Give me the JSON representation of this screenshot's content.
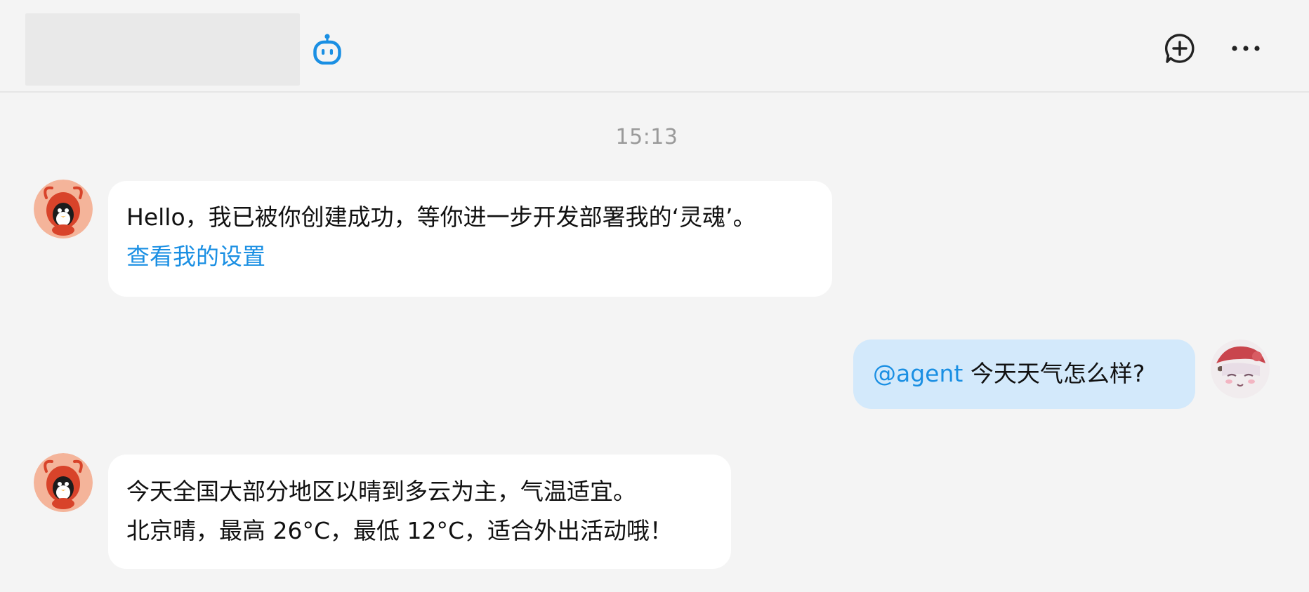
{
  "header": {
    "bot_icon": "robot-icon",
    "add_icon": "add-comment-icon",
    "more_icon": "more-dots-icon"
  },
  "timestamp": "15:13",
  "messages": [
    {
      "sender": "agent",
      "lines": [
        "Hello，我已被你创建成功，等你进一步开发部署我的‘灵魂’。"
      ],
      "link": "查看我的设置"
    },
    {
      "sender": "user",
      "mention": "@agent",
      "text": " 今天天气怎么样?"
    },
    {
      "sender": "agent",
      "lines": [
        "今天全国大部分地区以晴到多云为主，气温适宜。",
        "北京晴，最高 26°C，最低 12°C，适合外出活动哦！"
      ]
    }
  ],
  "colors": {
    "background": "#f4f4f4",
    "accent": "#1a8fe3",
    "user_bubble": "#d3e9fb",
    "agent_bubble": "#ffffff",
    "timestamp": "#9a9a9a"
  }
}
